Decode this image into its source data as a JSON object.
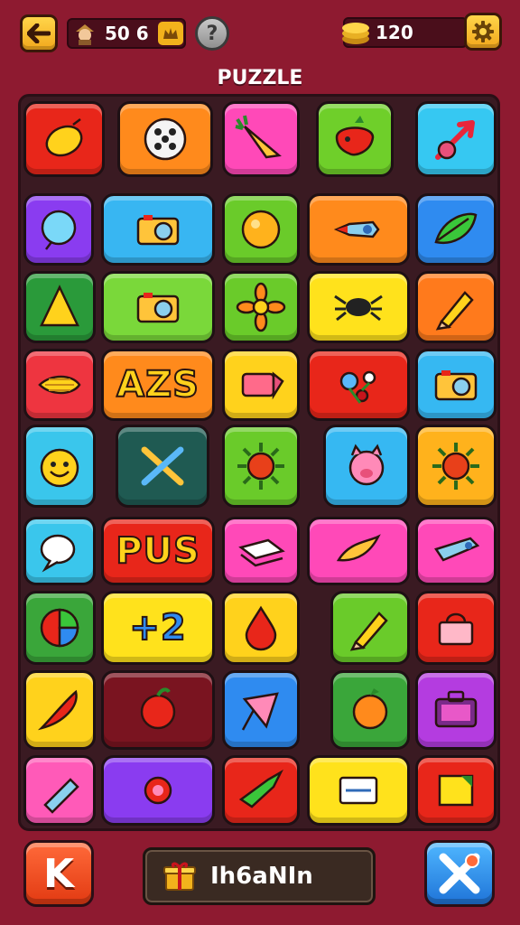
{
  "header": {
    "back_icon": "arrow-left-icon",
    "level_value": "50 6",
    "level_avatar_icon": "character-avatar-icon",
    "level_badge_icon": "crown-badge-icon",
    "help_label": "?",
    "coins_icon": "coin-stack-icon",
    "coins_value": "120",
    "settings_icon": "gear-icon"
  },
  "title": "PUZZLE",
  "tiles": [
    {
      "icon": "lemon-icon",
      "color": "#e8261a"
    },
    {
      "icon": "dice-icon",
      "color": "#ff8a1c"
    },
    {
      "icon": "carrot-icon",
      "color": "#ff49b8"
    },
    {
      "icon": "strawberry-icon",
      "color": "#6fcf2a"
    },
    {
      "icon": "arrow-icon",
      "color": "#36c8f2"
    },
    {
      "icon": "balloon-icon",
      "color": "#8a3cf0"
    },
    {
      "icon": "camera-icon",
      "color": "#38b6f2"
    },
    {
      "icon": "ball-icon",
      "color": "#6acb2a"
    },
    {
      "icon": "rocket-icon",
      "color": "#ff8a1c"
    },
    {
      "icon": "leaf-icon",
      "color": "#2f8bf0"
    },
    {
      "icon": "cone-icon",
      "color": "#2a9a3a"
    },
    {
      "icon": "camera-icon",
      "color": "#7ad83a"
    },
    {
      "icon": "flower-icon",
      "color": "#6acb2a"
    },
    {
      "icon": "spider-icon",
      "color": "#ffe21c"
    },
    {
      "icon": "pencil-icon",
      "color": "#ff7a1c"
    },
    {
      "icon": "hay-icon",
      "color": "#ee3540"
    },
    {
      "icon": "text-tile",
      "text": "AZS",
      "color": "#ff8a1c"
    },
    {
      "icon": "eraser-icon",
      "color": "#ffd21c"
    },
    {
      "icon": "flowers-icon",
      "color": "#e8261a"
    },
    {
      "icon": "camera-icon",
      "color": "#36b8f2"
    },
    {
      "icon": "smiley-icon",
      "color": "#3ac6ec"
    },
    {
      "icon": "paintbrush-icon",
      "color": "#1f5a52"
    },
    {
      "icon": "sun-icon",
      "color": "#6acb2a"
    },
    {
      "icon": "pig-icon",
      "color": "#36b8f2"
    },
    {
      "icon": "sun-icon",
      "color": "#ffb21c"
    },
    {
      "icon": "speech-bubble-icon",
      "color": "#3ac6ec"
    },
    {
      "icon": "text-tile",
      "text": "PUS",
      "color": "#e8261a"
    },
    {
      "icon": "paper-stack-icon",
      "color": "#ff49b8"
    },
    {
      "icon": "bird-icon",
      "color": "#ff49b8"
    },
    {
      "icon": "stapler-icon",
      "color": "#ff49b8"
    },
    {
      "icon": "pie-chart-icon",
      "color": "#3aa63a"
    },
    {
      "icon": "text-tile",
      "text": "+2",
      "color": "#ffe21c"
    },
    {
      "icon": "drop-icon",
      "color": "#ffd21c"
    },
    {
      "icon": "pencil-icon",
      "color": "#6acb2a"
    },
    {
      "icon": "basket-icon",
      "color": "#e8261a"
    },
    {
      "icon": "chili-icon",
      "color": "#ffd21c"
    },
    {
      "icon": "apple-icon",
      "color": "#7a1420"
    },
    {
      "icon": "kite-icon",
      "color": "#2f8bf0"
    },
    {
      "icon": "orange-icon",
      "color": "#3aa63a"
    },
    {
      "icon": "suitcase-icon",
      "color": "#b43ce0"
    },
    {
      "icon": "bottle-icon",
      "color": "#ff5ab8"
    },
    {
      "icon": "candy-icon",
      "color": "#8a3cf0"
    },
    {
      "icon": "airplane-icon",
      "color": "#e8261a"
    },
    {
      "icon": "label-icon",
      "color": "#ffe21c"
    },
    {
      "icon": "note-icon",
      "color": "#e8261a"
    }
  ],
  "footer": {
    "undo_label": "K",
    "hint_icon": "gift-box-icon",
    "hint_label": "Ih6aNIn",
    "shuffle_icon": "shuffle-x-icon"
  }
}
